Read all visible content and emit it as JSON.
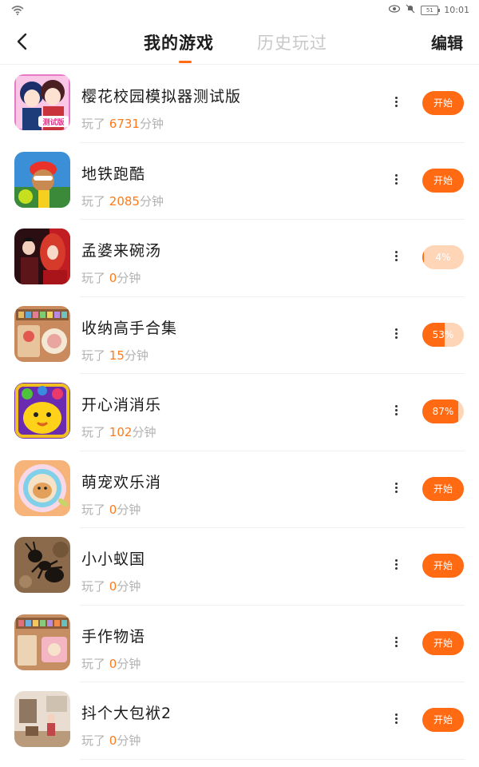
{
  "status_bar": {
    "time": "10:01",
    "battery": "51",
    "icons": [
      "wifi-icon",
      "eye-icon",
      "mute-icon",
      "battery-icon"
    ]
  },
  "header": {
    "tabs": [
      {
        "label": "我的游戏",
        "active": true
      },
      {
        "label": "历史玩过",
        "active": false
      }
    ],
    "edit_label": "编辑"
  },
  "colors": {
    "accent": "#ff6a13",
    "accent_light": "#ffd5b8",
    "played_number": "#ff7a1a",
    "muted_text": "#b2b2b2"
  },
  "games": [
    {
      "name": "樱花校园模拟器测试版",
      "played_prefix": "玩了",
      "minutes": "6731",
      "played_suffix": "分钟",
      "action": "开始",
      "thumb_badge": "测试版"
    },
    {
      "name": "地铁跑酷",
      "played_prefix": "玩了",
      "minutes": "2085",
      "played_suffix": "分钟",
      "action": "开始"
    },
    {
      "name": "孟婆来碗汤",
      "played_prefix": "玩了",
      "minutes": "0",
      "played_suffix": "分钟",
      "action": "4%",
      "progress": 0.04
    },
    {
      "name": "收纳高手合集",
      "played_prefix": "玩了",
      "minutes": "15",
      "played_suffix": "分钟",
      "action": "53%",
      "progress": 0.53
    },
    {
      "name": "开心消消乐",
      "played_prefix": "玩了",
      "minutes": "102",
      "played_suffix": "分钟",
      "action": "87%",
      "progress": 0.87
    },
    {
      "name": "萌宠欢乐消",
      "played_prefix": "玩了",
      "minutes": "0",
      "played_suffix": "分钟",
      "action": "开始"
    },
    {
      "name": "小小蚁国",
      "played_prefix": "玩了",
      "minutes": "0",
      "played_suffix": "分钟",
      "action": "开始"
    },
    {
      "name": "手作物语",
      "played_prefix": "玩了",
      "minutes": "0",
      "played_suffix": "分钟",
      "action": "开始"
    },
    {
      "name": "抖个大包袱2",
      "played_prefix": "玩了",
      "minutes": "0",
      "played_suffix": "分钟",
      "action": "开始"
    }
  ]
}
